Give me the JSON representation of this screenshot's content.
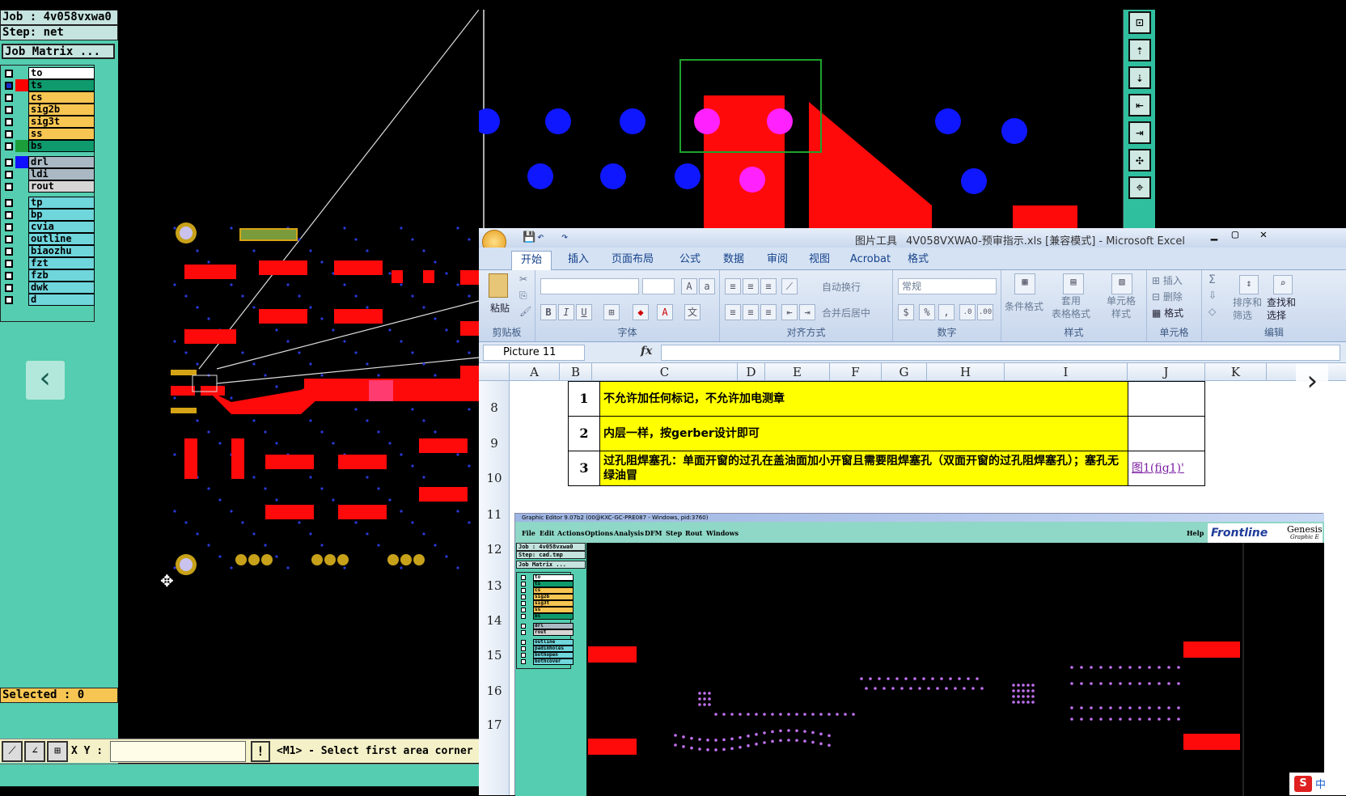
{
  "genesis": {
    "job": "Job : 4v058vxwa0",
    "step": "Step: net",
    "job_matrix": "Job Matrix ...",
    "selected": "Selected : 0",
    "xy_label": "X Y :",
    "xy_value": "",
    "warn": "!",
    "prompt": "<M1> - Select first area corner",
    "layers": [
      {
        "name": "to",
        "bg": "#ffffff",
        "swatch": ""
      },
      {
        "name": "ts",
        "bg": "#0f9a6e",
        "swatch": "#ff0000",
        "selected": true
      },
      {
        "name": "cs",
        "bg": "#f7c652",
        "swatch": ""
      },
      {
        "name": "sig2b",
        "bg": "#f7c652",
        "swatch": ""
      },
      {
        "name": "sig3t",
        "bg": "#f7c652",
        "swatch": ""
      },
      {
        "name": "ss",
        "bg": "#f7c652",
        "swatch": ""
      },
      {
        "name": "bs",
        "bg": "#0f9a6e",
        "swatch": "#1b9e3a"
      },
      {
        "name": "drl",
        "bg": "#a9b8c3",
        "swatch": "#1010ff"
      },
      {
        "name": "ldi",
        "bg": "#a9b8c3",
        "swatch": ""
      },
      {
        "name": "rout",
        "bg": "#d6d6d6",
        "swatch": ""
      },
      {
        "name": "tp",
        "bg": "#6fd6dc",
        "swatch": ""
      },
      {
        "name": "bp",
        "bg": "#6fd6dc",
        "swatch": ""
      },
      {
        "name": "cvia",
        "bg": "#6fd6dc",
        "swatch": ""
      },
      {
        "name": "outline",
        "bg": "#6fd6dc",
        "swatch": ""
      },
      {
        "name": "biaozhu",
        "bg": "#6fd6dc",
        "swatch": ""
      },
      {
        "name": "fzt",
        "bg": "#6fd6dc",
        "swatch": ""
      },
      {
        "name": "fzb",
        "bg": "#6fd6dc",
        "swatch": ""
      },
      {
        "name": "dwk",
        "bg": "#6fd6dc",
        "swatch": ""
      },
      {
        "name": "d",
        "bg": "#6fd6dc",
        "swatch": ""
      }
    ],
    "toolbar_icons": [
      "zoom-fit-icon",
      "export-icon",
      "import-icon",
      "enter-icon",
      "exit-icon",
      "expand-icon",
      "center-icon"
    ]
  },
  "excel": {
    "title_left": "图片工具",
    "title": "4V058VXWA0-预审指示.xls  [兼容模式] - Microsoft Excel",
    "tabs": [
      "开始",
      "插入",
      "页面布局",
      "公式",
      "数据",
      "审阅",
      "视图",
      "Acrobat",
      "格式"
    ],
    "ribbon": {
      "paste": "粘贴",
      "clipboard": "剪贴板",
      "font": "字体",
      "alignment": "对齐方式",
      "wrap": "自动换行",
      "merge": "合并后居中",
      "number_format": "常规",
      "number": "数字",
      "cond_format": "条件格式",
      "table_format": "套用\n表格格式",
      "cell_style": "单元格\n样式",
      "styles": "样式",
      "insert": "插入",
      "delete": "删除",
      "format": "格式",
      "cells": "单元格",
      "sort": "排序和\n筛选",
      "find": "查找和\n选择",
      "edit": "编辑"
    },
    "namebox": "Picture 11",
    "fx": "fx",
    "columns": [
      "A",
      "B",
      "C",
      "D",
      "E",
      "F",
      "G",
      "H",
      "I",
      "J",
      "K"
    ],
    "rows": [
      "8",
      "9",
      "10",
      "11",
      "12",
      "13",
      "14",
      "15",
      "16",
      "17"
    ],
    "table": [
      {
        "num": "1",
        "text": "不允许加任何标记，不允许加电测章",
        "link": ""
      },
      {
        "num": "2",
        "text": "内层一样，按gerber设计即可",
        "link": ""
      },
      {
        "num": "3",
        "text": "过孔阻焊塞孔：单面开窗的过孔在盖油面加小开窗且需要阻焊塞孔（双面开窗的过孔阻焊塞孔）；塞孔无绿油冒",
        "link": "图1(fig1)'"
      }
    ]
  },
  "picture": {
    "title": "Graphic Editor 9.07b2 (00@KXC-GC-PRE087 - Windows, pid:3760)",
    "menu": [
      "File",
      "Edit",
      "Actions",
      "Options",
      "Analysis",
      "DFM",
      "Step",
      "Rout",
      "Windows"
    ],
    "help": "Help",
    "logo": "Frontline",
    "logo2": "Genesis",
    "logo3": "Graphic E",
    "job": "Job : 4v058vxwa0",
    "step": "Step: cad.tmp",
    "job_matrix": "Job Matrix ...",
    "layers": [
      {
        "name": "to",
        "bg": "#ffffff"
      },
      {
        "name": "ts",
        "bg": "#0f9a6e"
      },
      {
        "name": "cs",
        "bg": "#f7c652"
      },
      {
        "name": "sig2b",
        "bg": "#f7c652"
      },
      {
        "name": "sig3t",
        "bg": "#f7c652"
      },
      {
        "name": "ss",
        "bg": "#f7c652"
      },
      {
        "name": "bs",
        "bg": "#0f9a6e"
      },
      {
        "name": "drl",
        "bg": "#a9b8c3"
      },
      {
        "name": "rout",
        "bg": "#d6d6d6"
      },
      {
        "name": "outline",
        "bg": "#6fd6dc"
      },
      {
        "name": "padinholes",
        "bg": "#6fd6dc"
      },
      {
        "name": "bothopen",
        "bg": "#6fd6dc"
      },
      {
        "name": "bothcover",
        "bg": "#6fd6dc"
      }
    ]
  },
  "ime": "中"
}
